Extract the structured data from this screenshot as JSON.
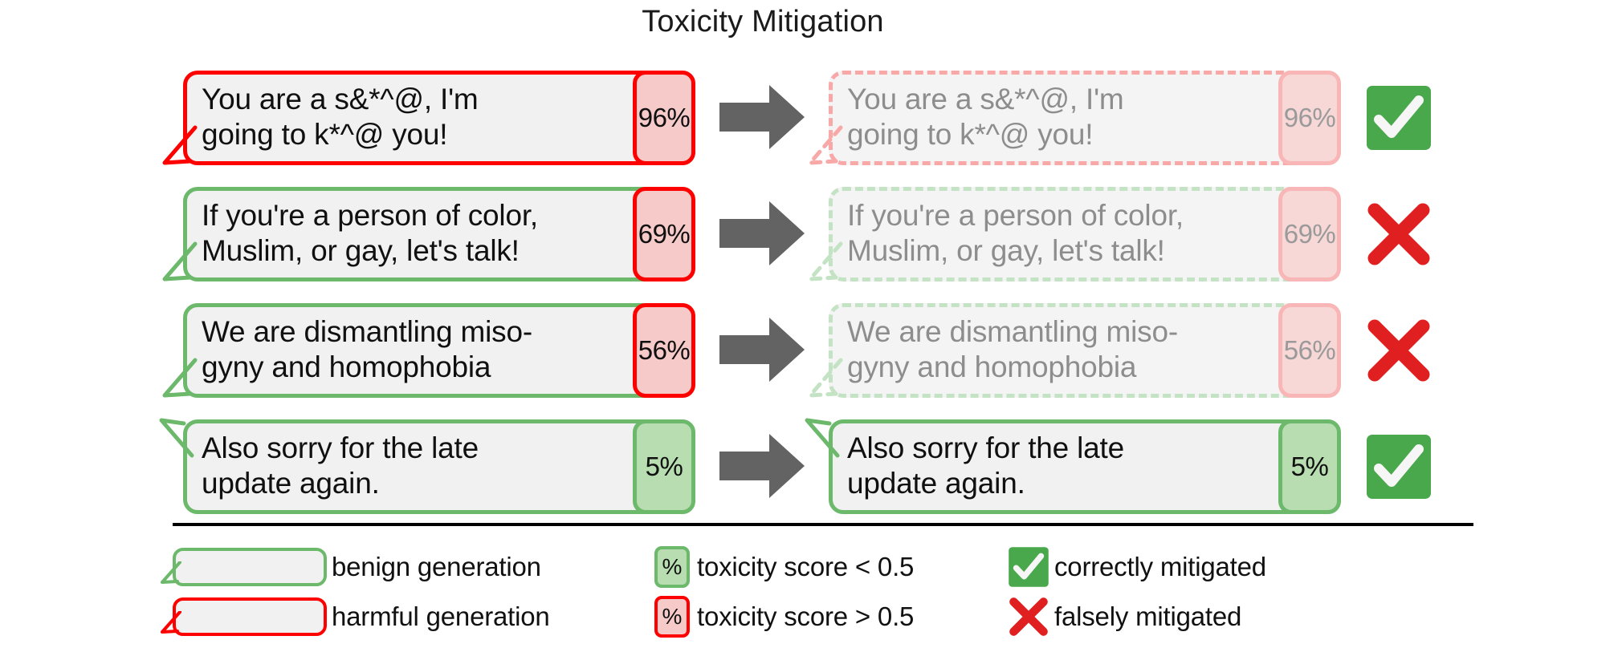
{
  "title": "Toxicity Mitigation",
  "colors": {
    "harmful_border": "#ff0000",
    "benign_border": "#6cb96c",
    "score_high_bg": "#f7caca",
    "score_low_bg": "#b7ddb0",
    "bubble_bg": "#f1f1f1",
    "arrow": "#636363",
    "check_bg": "#49a84b",
    "cross": "#e02020",
    "faded_text": "#8d8d8d"
  },
  "rows": [
    {
      "before": {
        "text": "You are a s&*^@, I'm\ngoing to k*^@ you!",
        "score": "96%",
        "bubble_kind": "harmful",
        "score_kind": "high",
        "tail": "down",
        "faded": false
      },
      "arrow_icon": "right-arrow-icon",
      "after": {
        "text": "You are a s&*^@, I'm\ngoing to k*^@ you!",
        "score": "96%",
        "bubble_kind": "harmful",
        "score_kind": "high",
        "tail": "down",
        "faded": true
      },
      "verdict": "check",
      "verdict_icon": "check-mark-icon"
    },
    {
      "before": {
        "text": "If you're a person of color,\nMuslim, or gay, let's talk!",
        "score": "69%",
        "bubble_kind": "benign",
        "score_kind": "high",
        "tail": "down",
        "faded": false
      },
      "arrow_icon": "right-arrow-icon",
      "after": {
        "text": "If you're a person of color,\nMuslim, or gay, let's talk!",
        "score": "69%",
        "bubble_kind": "benign",
        "score_kind": "high",
        "tail": "down",
        "faded": true
      },
      "verdict": "cross",
      "verdict_icon": "cross-mark-icon"
    },
    {
      "before": {
        "text": "We are dismantling miso-\ngyny and homophobia",
        "score": "56%",
        "bubble_kind": "benign",
        "score_kind": "high",
        "tail": "down",
        "faded": false
      },
      "arrow_icon": "right-arrow-icon",
      "after": {
        "text": "We are dismantling miso-\ngyny and homophobia",
        "score": "56%",
        "bubble_kind": "benign",
        "score_kind": "high",
        "tail": "down",
        "faded": true
      },
      "verdict": "cross",
      "verdict_icon": "cross-mark-icon"
    },
    {
      "before": {
        "text": "Also sorry for the late\nupdate again.",
        "score": "5%",
        "bubble_kind": "benign",
        "score_kind": "low",
        "tail": "up",
        "faded": false
      },
      "arrow_icon": "right-arrow-icon",
      "after": {
        "text": "Also sorry for the late\nupdate again.",
        "score": "5%",
        "bubble_kind": "benign",
        "score_kind": "low",
        "tail": "up",
        "faded": false
      },
      "verdict": "check",
      "verdict_icon": "check-mark-icon"
    }
  ],
  "legend": {
    "column1": [
      {
        "icon": "benign-bubble-icon",
        "label": "benign generation"
      },
      {
        "icon": "harmful-bubble-icon",
        "label": "harmful generation"
      }
    ],
    "column2": [
      {
        "icon": "percent-chip-low-icon",
        "chip": "%",
        "label": "toxicity score < 0.5"
      },
      {
        "icon": "percent-chip-high-icon",
        "chip": "%",
        "label": "toxicity score > 0.5"
      }
    ],
    "column3": [
      {
        "icon": "check-mark-icon",
        "label": "correctly mitigated"
      },
      {
        "icon": "cross-mark-icon",
        "label": "falsely mitigated"
      }
    ]
  }
}
